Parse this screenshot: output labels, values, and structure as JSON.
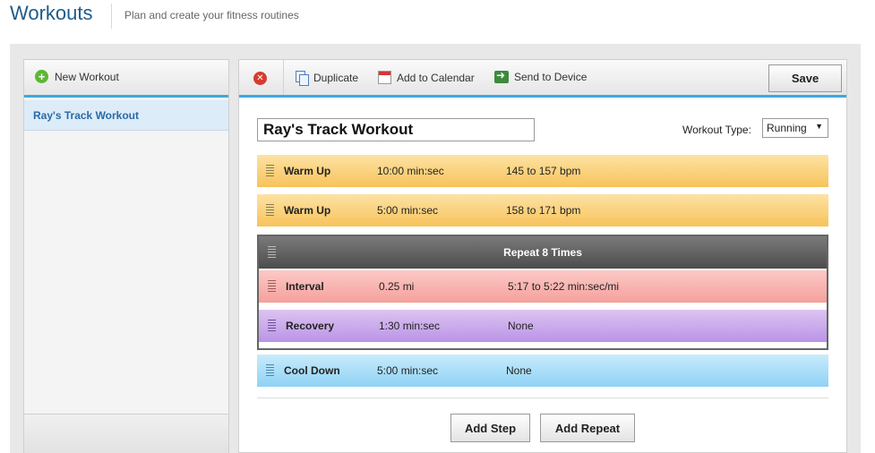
{
  "header": {
    "title": "Workouts",
    "subtitle": "Plan and create your fitness routines"
  },
  "sidebar": {
    "new_label": "New Workout",
    "items": [
      {
        "label": "Ray's Track Workout"
      }
    ]
  },
  "toolbar": {
    "duplicate_label": "Duplicate",
    "calendar_label": "Add to Calendar",
    "device_label": "Send to Device",
    "save_label": "Save"
  },
  "workout": {
    "name": "Ray's Track Workout",
    "type_label": "Workout Type:",
    "type_value": "Running",
    "steps": [
      {
        "name": "Warm Up",
        "duration": "10:00 min:sec",
        "target": "145 to 157 bpm"
      },
      {
        "name": "Warm Up",
        "duration": "5:00 min:sec",
        "target": "158 to 171 bpm"
      }
    ],
    "repeat": {
      "label": "Repeat 8 Times",
      "steps": [
        {
          "name": "Interval",
          "duration": "0.25 mi",
          "target": "5:17 to 5:22 min:sec/mi"
        },
        {
          "name": "Recovery",
          "duration": "1:30 min:sec",
          "target": "None"
        }
      ]
    },
    "cooldown": {
      "name": "Cool Down",
      "duration": "5:00 min:sec",
      "target": "None"
    }
  },
  "actions": {
    "add_step_label": "Add Step",
    "add_repeat_label": "Add Repeat"
  },
  "colors": {
    "accent": "#3aa9de",
    "warmup": "#f7c35a",
    "interval": "#f5a09c",
    "recovery": "#bb94e6",
    "cooldown": "#8ed2f5",
    "repeat_header": "#4c4c4c"
  }
}
